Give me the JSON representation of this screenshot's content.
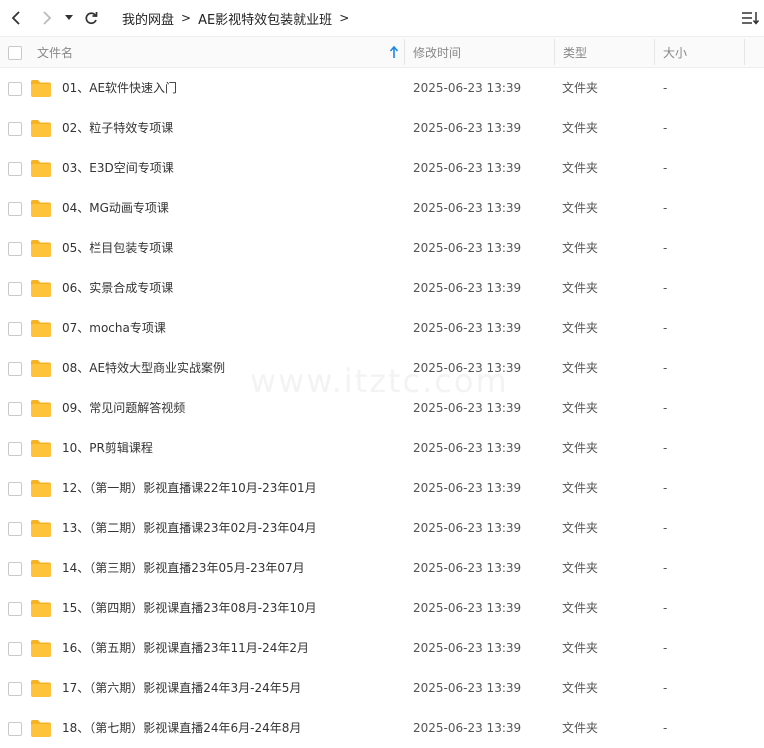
{
  "toolbar": {
    "back_icon": "chevron-left-icon",
    "forward_icon": "chevron-right-icon",
    "dropdown_icon": "caret-down-icon",
    "refresh_icon": "refresh-icon",
    "view_icon": "sort-list-icon"
  },
  "breadcrumb": {
    "items": [
      "我的网盘",
      "AE影视特效包装就业班"
    ],
    "separator": ">"
  },
  "columns": {
    "name": "文件名",
    "modified": "修改时间",
    "type": "类型",
    "size": "大小"
  },
  "files": [
    {
      "name": "01、AE软件快速入门",
      "modified": "2025-06-23 13:39",
      "type": "文件夹",
      "size": "-"
    },
    {
      "name": "02、粒子特效专项课",
      "modified": "2025-06-23 13:39",
      "type": "文件夹",
      "size": "-"
    },
    {
      "name": "03、E3D空间专项课",
      "modified": "2025-06-23 13:39",
      "type": "文件夹",
      "size": "-"
    },
    {
      "name": "04、MG动画专项课",
      "modified": "2025-06-23 13:39",
      "type": "文件夹",
      "size": "-"
    },
    {
      "name": "05、栏目包装专项课",
      "modified": "2025-06-23 13:39",
      "type": "文件夹",
      "size": "-"
    },
    {
      "name": "06、实景合成专项课",
      "modified": "2025-06-23 13:39",
      "type": "文件夹",
      "size": "-"
    },
    {
      "name": "07、mocha专项课",
      "modified": "2025-06-23 13:39",
      "type": "文件夹",
      "size": "-"
    },
    {
      "name": "08、AE特效大型商业实战案例",
      "modified": "2025-06-23 13:39",
      "type": "文件夹",
      "size": "-"
    },
    {
      "name": "09、常见问题解答视频",
      "modified": "2025-06-23 13:39",
      "type": "文件夹",
      "size": "-"
    },
    {
      "name": "10、PR剪辑课程",
      "modified": "2025-06-23 13:39",
      "type": "文件夹",
      "size": "-"
    },
    {
      "name": "12、（第一期）影视直播课22年10月-23年01月",
      "modified": "2025-06-23 13:39",
      "type": "文件夹",
      "size": "-"
    },
    {
      "name": "13、（第二期）影视直播课23年02月-23年04月",
      "modified": "2025-06-23 13:39",
      "type": "文件夹",
      "size": "-"
    },
    {
      "name": "14、（第三期）影视直播23年05月-23年07月",
      "modified": "2025-06-23 13:39",
      "type": "文件夹",
      "size": "-"
    },
    {
      "name": "15、（第四期）影视课直播23年08月-23年10月",
      "modified": "2025-06-23 13:39",
      "type": "文件夹",
      "size": "-"
    },
    {
      "name": "16、（第五期）影视课直播23年11月-24年2月",
      "modified": "2025-06-23 13:39",
      "type": "文件夹",
      "size": "-"
    },
    {
      "name": "17、（第六期）影视课直播24年3月-24年5月",
      "modified": "2025-06-23 13:39",
      "type": "文件夹",
      "size": "-"
    },
    {
      "name": "18、（第七期）影视课直播24年6月-24年8月",
      "modified": "2025-06-23 13:39",
      "type": "文件夹",
      "size": "-"
    }
  ],
  "watermark": "www.itztc.com",
  "colors": {
    "folder": "#FFC23A",
    "folder_tab": "#F5B221",
    "sort_arrow": "#1E88E5"
  }
}
